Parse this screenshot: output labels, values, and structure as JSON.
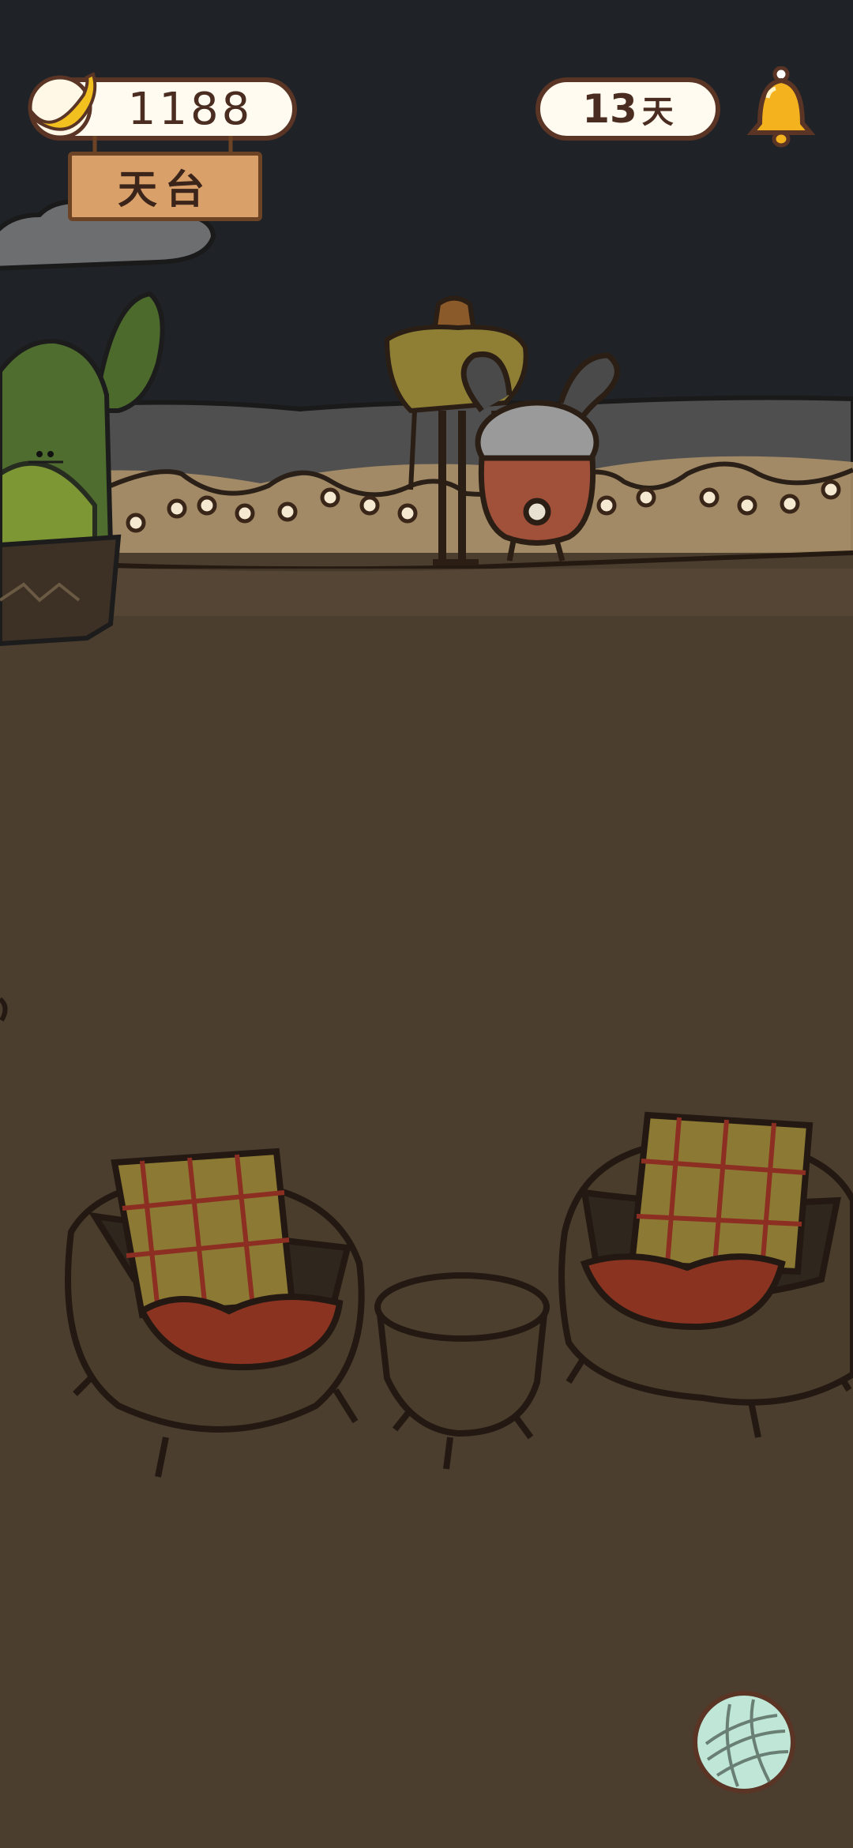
{
  "hud": {
    "banana_count": "1188",
    "days_value": "13",
    "days_unit": "天"
  },
  "location_sign": "天台",
  "icons": {
    "currency": "banana-icon",
    "notification": "bell-icon",
    "menu": "yarn-ball-icon"
  },
  "colors": {
    "sky": "#1f2327",
    "floor": "#4b3e2e",
    "wall": "#4d4d4d",
    "string_lights": "#e9b56e",
    "pill_border": "#5a3424",
    "pill_fill": "#fffbf0"
  }
}
